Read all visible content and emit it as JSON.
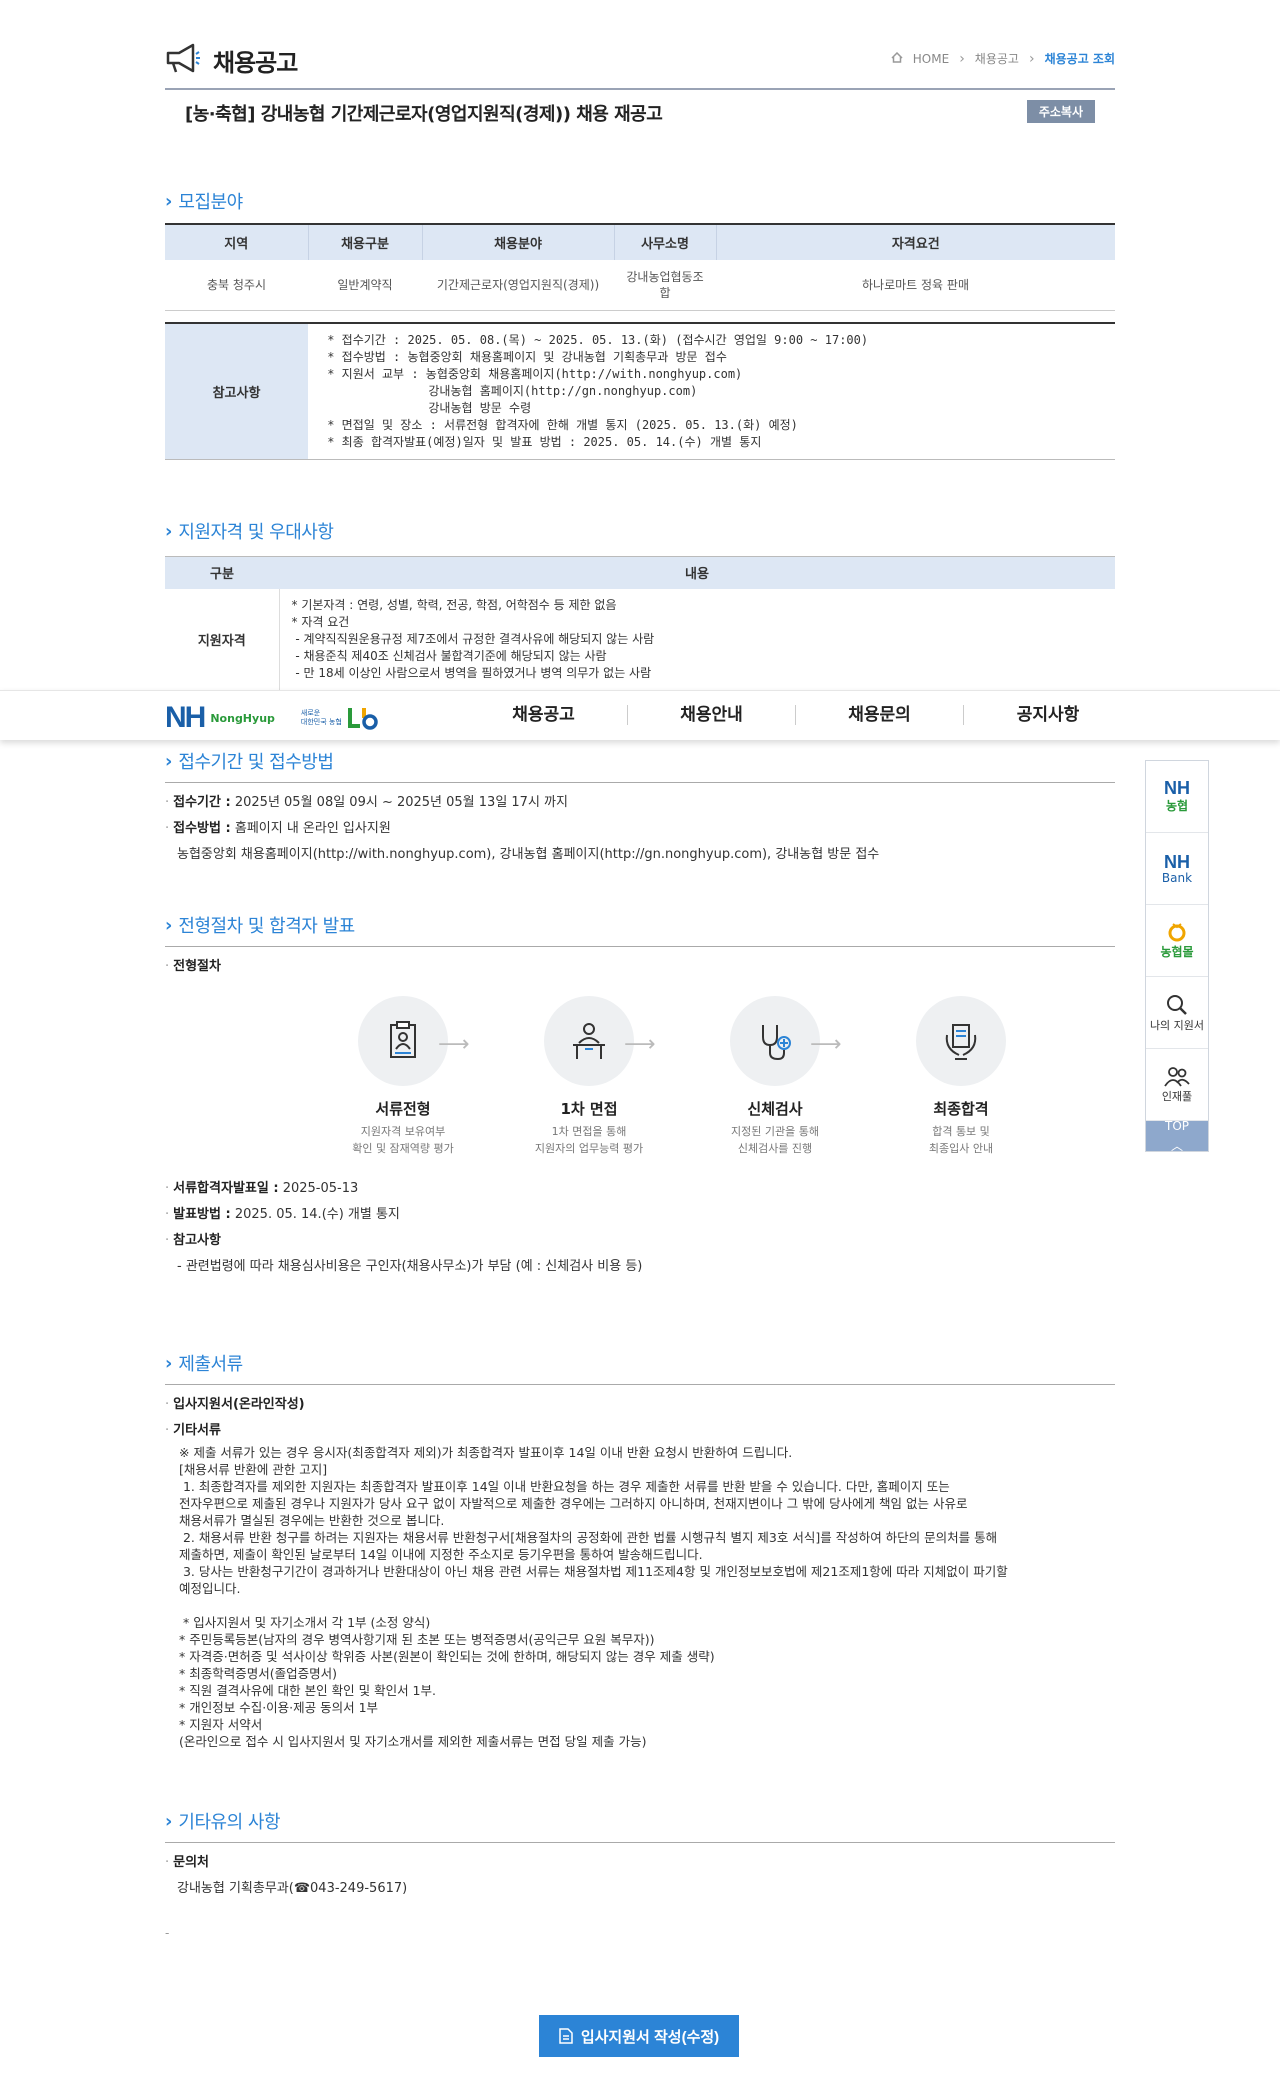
{
  "header": {
    "title": "채용공고",
    "breadcrumb": [
      "HOME",
      "채용공고",
      "채용공고 조회"
    ]
  },
  "notice": {
    "title": "[농·축협] 강내농협 기간제근로자(영업지원직(경제)) 채용 재공고",
    "copy_label": "주소복사"
  },
  "recruit": {
    "title": "모집분야",
    "columns": [
      "지역",
      "채용구분",
      "채용분야",
      "사무소명",
      "자격요건"
    ],
    "row": [
      "충북 청주시",
      "일반계약직",
      "기간제근로자(영업지원직(경제))",
      "강내농업협동조\n합",
      "하나로마트 정육 판매"
    ],
    "ref_label": "참고사항",
    "ref_text": " * 접수기간 : 2025. 05. 08.(목) ~ 2025. 05. 13.(화) (접수시간 영업일 9:00 ~ 17:00)\n * 접수방법 : 농협중앙회 채용홈페이지 및 강내농협 기획총무과 방문 접수\n * 지원서 교부 : 농협중앙회 채용홈페이지(http://with.nonghyup.com)\n               강내농협 홈페이지(http://gn.nonghyup.com)\n               강내농협 방문 수령\n * 면접일 및 장소 : 서류전형 합격자에 한해 개별 통지 (2025. 05. 13.(화) 예정)\n * 최종 합격자발표(예정)일자 및 발표 방법 : 2025. 05. 14.(수) 개별 통지"
  },
  "qualification": {
    "title": "지원자격 및 우대사항",
    "columns": [
      "구분",
      "내용"
    ],
    "row_label": "지원자격",
    "text": "* 기본자격 : 연령, 성별, 학력, 전공, 학점, 어학점수 등 제한 없음\n* 자격 요건\n - 계약직직원운용규정 제7조에서 규정한 결격사유에 해당되지 않는 사람\n - 채용준칙 제40조 신체검사 불합격기준에 해당되지 않는 사람\n - 만 18세 이상인 사람으로서 병역을 필하였거나 병역 의무가 없는 사람"
  },
  "topnav": {
    "logo_text": "NH",
    "logo_sub": "NongHyup",
    "badge_text": "새로운\n대한민국 농협",
    "menu": [
      "채용공고",
      "채용안내",
      "채용문의",
      "공지사항"
    ]
  },
  "period": {
    "title": "접수기간 및 접수방법",
    "period_label": "접수기간 :",
    "period_value": "2025년 05월 08일 09시 ~ 2025년 05월 13일 17시 까지",
    "method_label": "접수방법 :",
    "method_value": "홈페이지 내 온라인 입사지원",
    "method_detail": "농협중앙회 채용홈페이지(http://with.nonghyup.com), 강내농협 홈페이지(http://gn.nonghyup.com), 강내농협 방문 접수"
  },
  "process": {
    "title": "전형절차 및 합격자 발표",
    "sub": "전형절차",
    "steps": [
      {
        "name": "서류전형",
        "desc": "지원자격 보유여부\n확인 및 잠재역량 평가"
      },
      {
        "name": "1차 면접",
        "desc": "1차 면접을 통해\n지원자의 업무능력 평가"
      },
      {
        "name": "신체검사",
        "desc": "지정된 기관을 통해\n신체검사를 진행"
      },
      {
        "name": "최종합격",
        "desc": "합격 통보 및\n최종입사 안내"
      }
    ],
    "doc_date_label": "서류합격자발표일 :",
    "doc_date": "2025-05-13",
    "announce_label": "발표방법 :",
    "announce": "2025. 05. 14.(수) 개별 통지",
    "note_label": "참고사항",
    "note": "- 관련법령에 따라 채용심사비용은 구인자(채용사무소)가 부담 (예 : 신체검사 비용 등)"
  },
  "documents": {
    "title": "제출서류",
    "item1": "입사지원서(온라인작성)",
    "item2": "기타서류",
    "text": "※ 제출 서류가 있는 경우 응시자(최종합격자 제외)가 최종합격자 발표이후 14일 이내 반환 요청시 반환하여 드립니다.\n[채용서류 반환에 관한 고지]\n 1. 최종합격자를 제외한 지원자는 최종합격자 발표이후 14일 이내 반환요청을 하는 경우 제출한 서류를 반환 받을 수 있습니다. 다만, 홈페이지 또는\n전자우편으로 제출된 경우나 지원자가 당사 요구 없이 자발적으로 제출한 경우에는 그러하지 아니하며, 천재지변이나 그 밖에 당사에게 책임 없는 사유로\n채용서류가 멸실된 경우에는 반환한 것으로 봅니다.\n 2. 채용서류 반환 청구를 하려는 지원자는 채용서류 반환청구서[채용절차의 공정화에 관한 법률 시행규칙 별지 제3호 서식]를 작성하여 하단의 문의처를 통해\n제출하면, 제출이 확인된 날로부터 14일 이내에 지정한 주소지로 등기우편을 통하여 발송해드립니다.\n 3. 당사는 반환청구기간이 경과하거나 반환대상이 아닌 채용 관련 서류는 채용절차법 제11조제4항 및 개인정보보호법에 제21조제1항에 따라 지체없이 파기할\n예정입니다.\n\n * 입사지원서 및 자기소개서 각 1부 (소정 양식)\n* 주민등록등본(남자의 경우 병역사항기재 된 초본 또는 병적증명서(공익근무 요원 복무자))\n* 자격증·면허증 및 석사이상 학위증 사본(원본이 확인되는 것에 한하며, 해당되지 않는 경우 제출 생략)\n* 최종학력증명서(졸업증명서)\n* 직원 결격사유에 대한 본인 확인 및 확인서 1부.\n* 개인정보 수집·이용·제공 동의서 1부\n* 지원자 서약서\n(온라인으로 접수 시 입사지원서 및 자기소개서를 제외한 제출서류는 면접 당일 제출 가능)"
  },
  "etc": {
    "title": "기타유의 사항",
    "contact_label": "문의처",
    "contact": "강내농협 기획총무과(☎043-249-5617)",
    "dash": "-"
  },
  "quick": {
    "items": [
      {
        "main": "NH",
        "sub": "농협"
      },
      {
        "main": "NH",
        "sub": "Bank"
      },
      {
        "main": "",
        "sub": "농협몰"
      },
      {
        "main": "",
        "sub": "나의 지원서"
      },
      {
        "main": "",
        "sub": "인재풀"
      }
    ],
    "top": "TOP"
  },
  "apply_button": "입사지원서 작성(수정)"
}
